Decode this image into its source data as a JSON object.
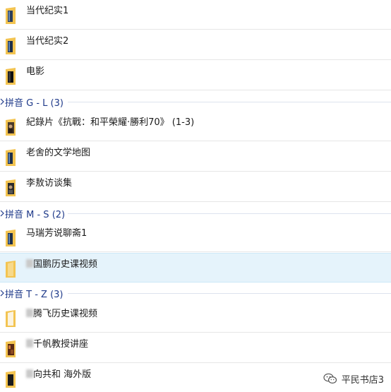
{
  "groups": [
    {
      "header": null,
      "items": [
        {
          "label": "当代纪实1"
        },
        {
          "label": "当代纪实2"
        },
        {
          "label": "电影"
        }
      ]
    },
    {
      "header": "拼音 G - L (3)",
      "items": [
        {
          "label": "紀錄片《抗戰：和平榮耀·勝利70》 (1-3)"
        },
        {
          "label": "老舍的文学地图"
        },
        {
          "label": "李敖访谈集"
        }
      ]
    },
    {
      "header": "拼音 M - S (2)",
      "items": [
        {
          "label": "马瑞芳说聊斋1"
        },
        {
          "label": "国鹏历史课视频"
        }
      ]
    },
    {
      "header": "拼音 T - Z (3)",
      "items": [
        {
          "label": "腾飞历史课视频"
        },
        {
          "label": "千帆教授讲座"
        },
        {
          "label": "向共和  海外版"
        }
      ]
    }
  ],
  "selected_item": "国鹏历史课视频",
  "watermark": {
    "text": "平民书店3",
    "icon": "wechat-icon"
  },
  "colors": {
    "group_header": "#1f3a8a",
    "selected_bg": "#e5f3fb",
    "folder_yellow": "#f3c451"
  }
}
